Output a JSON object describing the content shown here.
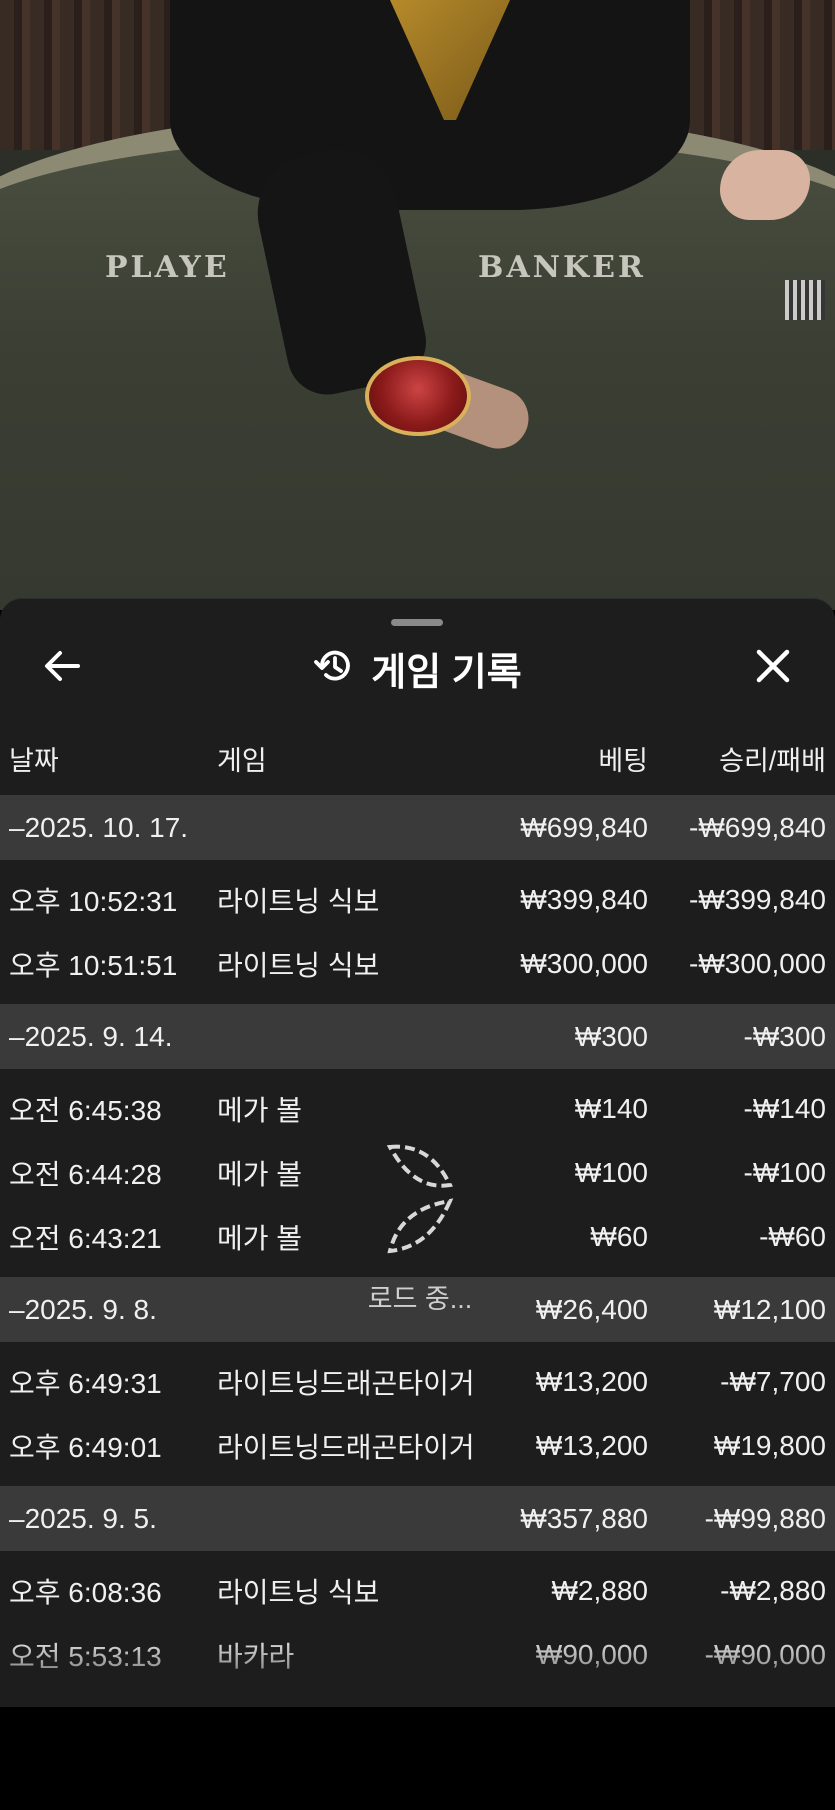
{
  "video": {
    "table_labels": [
      "PLAYE",
      "BANKER"
    ]
  },
  "sheet": {
    "title": "게임 기록",
    "icons": {
      "back": "arrow-left-icon",
      "history": "history-icon",
      "close": "close-icon"
    }
  },
  "columns": {
    "date": "날짜",
    "game": "게임",
    "bet": "베팅",
    "result": "승리/패배"
  },
  "records": [
    {
      "type": "group",
      "date": "–2025. 10. 17.",
      "bet": "₩699,840",
      "result": "-₩699,840"
    },
    {
      "type": "item",
      "date": "오후 10:52:31",
      "game": "라이트닝 식보",
      "bet": "₩399,840",
      "result": "-₩399,840"
    },
    {
      "type": "item",
      "date": "오후 10:51:51",
      "game": "라이트닝 식보",
      "bet": "₩300,000",
      "result": "-₩300,000"
    },
    {
      "type": "group",
      "date": "–2025. 9. 14.",
      "bet": "₩300",
      "result": "-₩300"
    },
    {
      "type": "item",
      "date": "오전 6:45:38",
      "game": "메가 볼",
      "bet": "₩140",
      "result": "-₩140"
    },
    {
      "type": "item",
      "date": "오전 6:44:28",
      "game": "메가 볼",
      "bet": "₩100",
      "result": "-₩100"
    },
    {
      "type": "item",
      "date": "오전 6:43:21",
      "game": "메가 볼",
      "bet": "₩60",
      "result": "-₩60"
    },
    {
      "type": "group",
      "date": "–2025. 9. 8.",
      "bet": "₩26,400",
      "result": "₩12,100"
    },
    {
      "type": "item",
      "date": "오후 6:49:31",
      "game": "라이트닝드래곤타이거",
      "bet": "₩13,200",
      "result": "-₩7,700"
    },
    {
      "type": "item",
      "date": "오후 6:49:01",
      "game": "라이트닝드래곤타이거",
      "bet": "₩13,200",
      "result": "₩19,800"
    },
    {
      "type": "group",
      "date": "–2025. 9. 5.",
      "bet": "₩357,880",
      "result": "-₩99,880"
    },
    {
      "type": "item",
      "date": "오후 6:08:36",
      "game": "라이트닝 식보",
      "bet": "₩2,880",
      "result": "-₩2,880"
    },
    {
      "type": "item",
      "date": "오전 5:53:13",
      "game": "바카라",
      "bet": "₩90,000",
      "result": "-₩90,000"
    }
  ],
  "loader": {
    "text": "로드 중..."
  },
  "colors": {
    "sheet_bg": "#1d1d1d",
    "group_row_bg": "#3a3a3a",
    "text": "#f0f0f0"
  }
}
